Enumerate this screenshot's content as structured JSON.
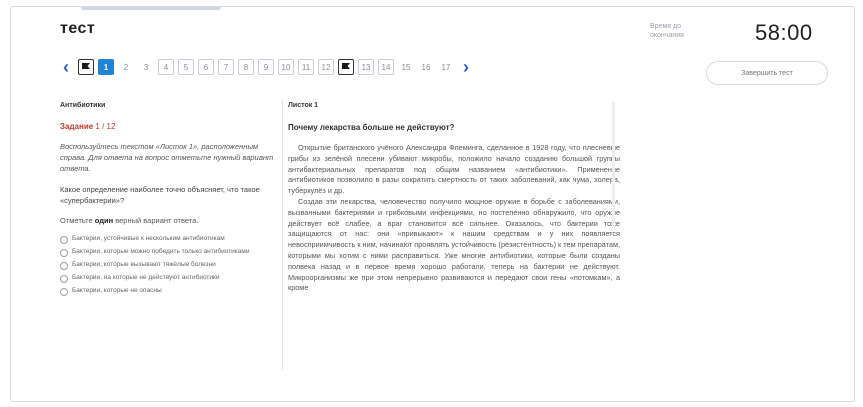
{
  "header": {
    "title": "тест",
    "timer_label": "Время до окончания",
    "timer": "58:00",
    "finish_button": "Завершить тест"
  },
  "navigation": {
    "prev": "‹",
    "next": "›",
    "questions": [
      "flag",
      "1",
      "2",
      "3",
      "4",
      "5",
      "6",
      "7",
      "8",
      "9",
      "10",
      "11",
      "12",
      "flag",
      "13",
      "14",
      "15",
      "16",
      "17"
    ],
    "active_index": 1
  },
  "left": {
    "caption": "Антибиотики",
    "task_label": "Задание",
    "task_number": "1 / 12",
    "instruction": "Воспользуйтесь текстом «Листок 1», расположенным справа. Для ответа на вопрос отметьте нужный вариант ответа.",
    "question": "Какое определение наиболее точно объясняет, что такое «супербактерии»?",
    "select_hint_pre": "Отметьте",
    "select_hint_bold": "один",
    "select_hint_post": "верный вариант ответа.",
    "options": [
      "Бактерии, устойчивые к нескольким антибиотикам",
      "Бактерии, которые можно победить только антибиотиками",
      "Бактерии, которые вызывают тяжёлые болезни",
      "Бактерии, на которые не действуют антибиотики",
      "Бактерии, которые не опасны"
    ]
  },
  "right": {
    "caption": "Листок 1",
    "title": "Почему лекарства больше не действуют?",
    "paragraphs": [
      "Открытие британского учёного Александра Флеминга, сделанное в 1928 году, что плесневые грибы из зелёной плесени убивают микробы, положило начало созданию большой группы антибактериальных препаратов под общим названием «антибиотики». Применение антибиотиков позволило в разы сократить смертность от таких заболеваний, как чума, холера, туберкулёз и др.",
      "Создав эти лекарства, человечество получило мощное оружие в борьбе с заболеваниями, вызванными бактериями и грибковыми инфекциями, но постепенно обнаружило, что оружие действует всё слабее, а враг становится всё сильнее. Оказалось, что бактерии тоже защищаются от нас: они «привыкают» к нашим средствам и у них появляется невосприимчивость к ним, начинают проявлять устойчивость (резистентность) к тем препаратам, которыми мы хотим с ними расправиться. Уже многие антибиотики, которые были созданы полвека назад и в первое время хорошо работали, теперь на бактерии не действуют. Микроорганизмы же при этом непрерывно развиваются и передают свои гены «потомкам», а кроме"
    ]
  }
}
